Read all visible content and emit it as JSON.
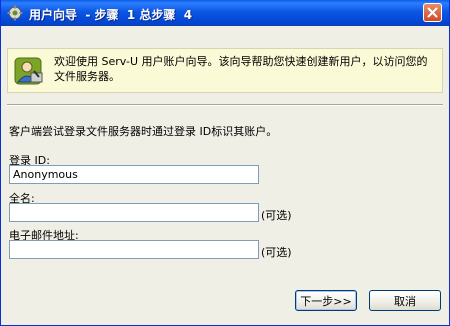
{
  "window": {
    "title": "用户向导  - 步骤  1 总步骤  4",
    "close_label": "✕"
  },
  "intro": {
    "text": "欢迎使用  Serv-U 用户账户向导。该向导帮助您快速创建新用户，以访问您的文件服务器。"
  },
  "instruction": "客户端尝试登录文件服务器时通过登录  ID标识其账户。",
  "fields": {
    "login_id": {
      "label": "登录  ID:",
      "value": "Anonymous"
    },
    "full_name": {
      "label": "全名:",
      "value": "",
      "optional": "(可选)"
    },
    "email": {
      "label": "电子邮件地址:",
      "value": "",
      "optional": "(可选)"
    }
  },
  "buttons": {
    "next": "下一步>>",
    "cancel": "取消"
  },
  "icons": {
    "title": "wizard-gear-icon",
    "intro": "user-wizard-icon",
    "close": "close-icon"
  }
}
